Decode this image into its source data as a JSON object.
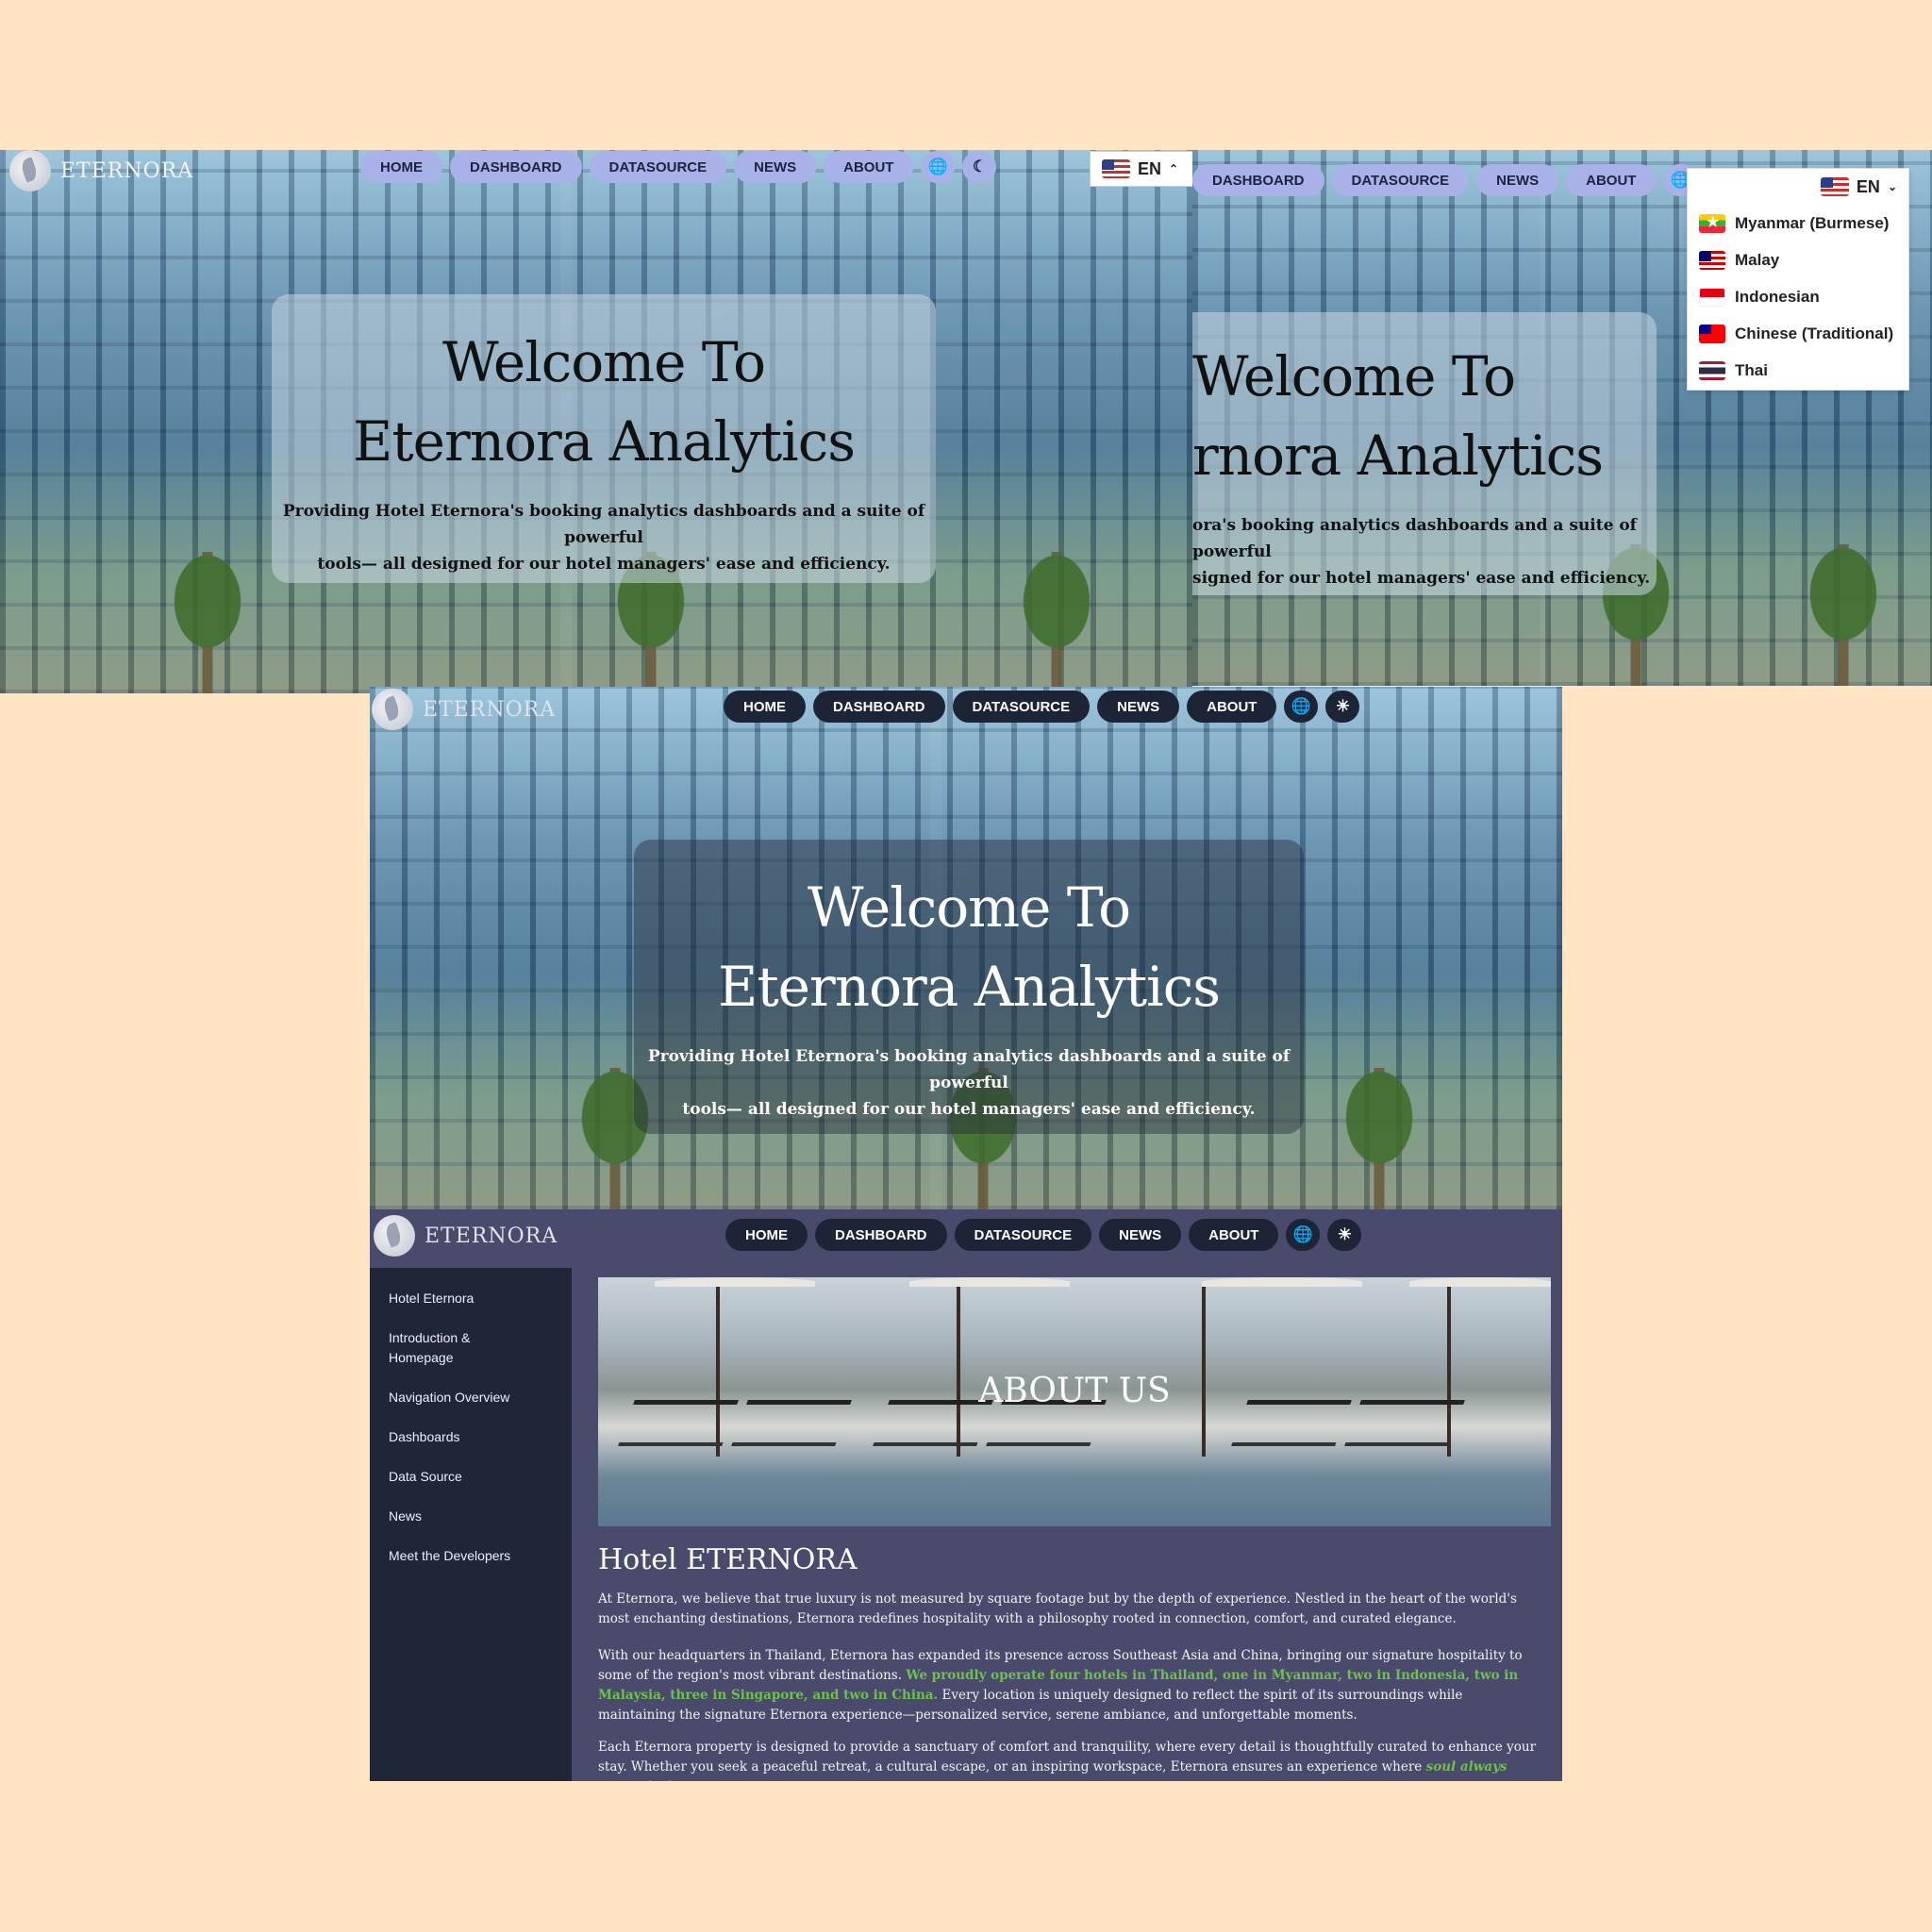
{
  "brand": {
    "name": "ETERNORA"
  },
  "nav": {
    "home": "HOME",
    "dashboard": "DASHBOARD",
    "datasource": "DATASOURCE",
    "news": "NEWS",
    "about": "ABOUT"
  },
  "icons": {
    "globe": "globe-icon",
    "moon": "moon-icon",
    "sun": "sun-icon",
    "logo": "leaf-logo"
  },
  "hero": {
    "title_line1": "Welcome To",
    "title_line2": "Eternora Analytics",
    "subtitle_line1": "Providing Hotel Eternora's booking analytics dashboards and a suite of powerful",
    "subtitle_line2": "tools— all designed for our hotel managers' ease and efficiency."
  },
  "hero_cropped": {
    "title_line1": "Welcome To",
    "title_line2": "rnora Analytics",
    "subtitle_line1": "ora's booking analytics dashboards and a suite of powerful",
    "subtitle_line2": "signed for our hotel managers' ease and efficiency."
  },
  "language": {
    "current": "EN",
    "options": [
      "Myanmar (Burmese)",
      "Malay",
      "Indonesian",
      "Chinese (Traditional)",
      "Thai"
    ]
  },
  "sidebar": {
    "items": [
      "Hotel Eternora",
      "Introduction & Homepage",
      "Navigation Overview",
      "Dashboards",
      "Data Source",
      "News",
      "Meet the Developers"
    ]
  },
  "about": {
    "banner_title": "ABOUT US",
    "heading": "Hotel ETERNORA",
    "p1": "At Eternora, we believe that true luxury is not measured by square footage but by the depth of experience. Nestled in the heart of the world's most enchanting destinations, Eternora redefines hospitality with a philosophy rooted in connection, comfort, and curated elegance.",
    "p2_start": "With our headquarters in Thailand, Eternora has expanded its presence across Southeast Asia and China, bringing our signature hospitality to some of the region's most vibrant destinations. ",
    "p2_highlight": "We proudly operate four hotels in Thailand, one in Myanmar, two in Indonesia, two in Malaysia, three in Singapore, and two in China.",
    "p2_end": " Every location is uniquely designed to reflect the spirit of its surroundings while maintaining the signature Eternora experience—personalized service, serene ambiance, and unforgettable moments.",
    "p3_start": "Each Eternora property is designed to provide a sanctuary of comfort and tranquility, where every detail is thoughtfully curated to enhance your stay. Whether you seek a peaceful retreat, a cultural escape, or an inspiring workspace, Eternora ensures an experience where ",
    "p3_highlight": "soul always comes before"
  },
  "colors": {
    "background": "#ffe5c4",
    "nav_light": "#a9b2e8",
    "nav_dark": "#1c2436",
    "header_purple": "#4a4a6c",
    "sidebar": "#1e2638",
    "highlight": "#6fc04c"
  }
}
